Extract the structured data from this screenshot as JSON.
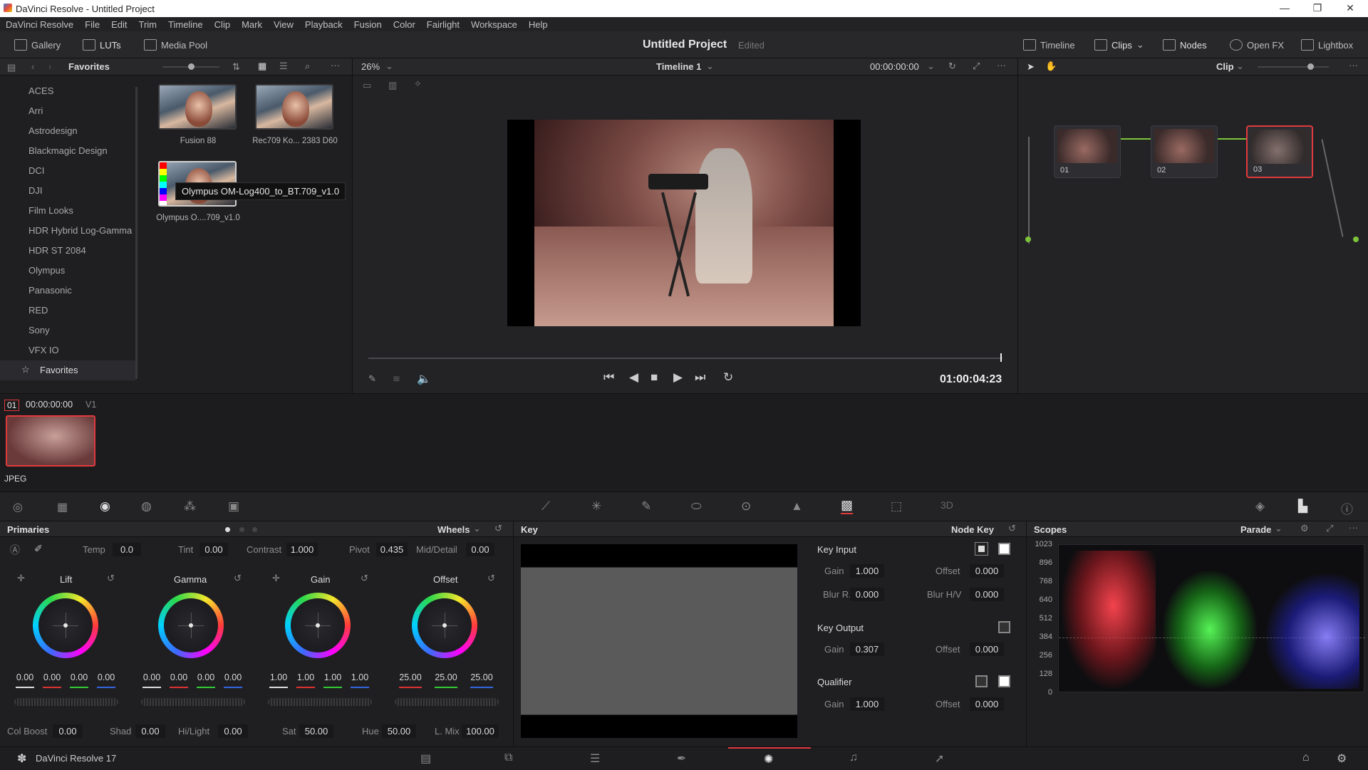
{
  "window": {
    "title": "DaVinci Resolve - Untitled Project",
    "minimize": "—",
    "maximize": "❐",
    "close": "✕"
  },
  "menu": [
    "DaVinci Resolve",
    "File",
    "Edit",
    "Trim",
    "Timeline",
    "Clip",
    "Mark",
    "View",
    "Playback",
    "Fusion",
    "Color",
    "Fairlight",
    "Workspace",
    "Help"
  ],
  "toolbar": {
    "gallery": "Gallery",
    "luts": "LUTs",
    "media_pool": "Media Pool",
    "project_title": "Untitled Project",
    "project_status": "Edited",
    "timeline": "Timeline",
    "clips": "Clips",
    "nodes": "Nodes",
    "open_fx": "Open FX",
    "lightbox": "Lightbox"
  },
  "lut_browser": {
    "title": "Favorites",
    "categories": [
      "ACES",
      "Arri",
      "Astrodesign",
      "Blackmagic Design",
      "DCI",
      "DJI",
      "Film Looks",
      "HDR Hybrid Log-Gamma",
      "HDR ST 2084",
      "Olympus",
      "Panasonic",
      "RED",
      "Sony",
      "VFX IO",
      "Favorites"
    ],
    "thumbnails": [
      {
        "label": "Fusion 88"
      },
      {
        "label": "Rec709 Ko... 2383 D60"
      },
      {
        "label": "Olympus O....709_v1.0"
      }
    ],
    "tooltip": "Olympus OM-Log400_to_BT.709_v1.0"
  },
  "viewer": {
    "zoom": "26%",
    "timeline_name": "Timeline 1",
    "timecode_top": "00:00:00:00",
    "timecode": "01:00:04:23",
    "clip_mode": "Clip"
  },
  "clip_strip": {
    "index": "01",
    "timecode": "00:00:00:00",
    "track": "V1",
    "format": "JPEG"
  },
  "primaries": {
    "title": "Primaries",
    "mode": "Wheels",
    "temp_label": "Temp",
    "temp": "0.0",
    "tint_label": "Tint",
    "tint": "0.00",
    "contrast_label": "Contrast",
    "contrast": "1.000",
    "pivot_label": "Pivot",
    "pivot": "0.435",
    "middetail_label": "Mid/Detail",
    "middetail": "0.00",
    "wheels": [
      {
        "name": "Lift",
        "values": [
          "0.00",
          "0.00",
          "0.00",
          "0.00"
        ]
      },
      {
        "name": "Gamma",
        "values": [
          "0.00",
          "0.00",
          "0.00",
          "0.00"
        ]
      },
      {
        "name": "Gain",
        "values": [
          "1.00",
          "1.00",
          "1.00",
          "1.00"
        ]
      },
      {
        "name": "Offset",
        "values": [
          "25.00",
          "25.00",
          "25.00"
        ]
      }
    ],
    "colboost_label": "Col Boost",
    "colboost": "0.00",
    "shad_label": "Shad",
    "shad": "0.00",
    "hilight_label": "Hi/Light",
    "hilight": "0.00",
    "sat_label": "Sat",
    "sat": "50.00",
    "hue_label": "Hue",
    "hue": "50.00",
    "lmix_label": "L. Mix",
    "lmix": "100.00"
  },
  "key": {
    "title": "Key",
    "node_key": "Node Key",
    "key_input": "Key Input",
    "key_output": "Key Output",
    "qualifier": "Qualifier",
    "gain_label": "Gain",
    "offset_label": "Offset",
    "blur_r_label": "Blur R.",
    "blur_hv_label": "Blur H/V",
    "input_gain": "1.000",
    "input_offset": "0.000",
    "blur_r": "0.000",
    "blur_hv": "0.000",
    "output_gain": "0.307",
    "output_offset": "0.000",
    "qual_gain": "1.000",
    "qual_offset": "0.000"
  },
  "scopes": {
    "title": "Scopes",
    "mode": "Parade",
    "ticks": [
      "1023",
      "896",
      "768",
      "640",
      "512",
      "384",
      "256",
      "128",
      "0"
    ]
  },
  "nodes": [
    "01",
    "02",
    "03"
  ],
  "footer": {
    "app": "DaVinci Resolve 17"
  },
  "colors": {
    "accent_red": "#e03a3e",
    "panel_bg": "#1f1f22",
    "header_bg": "#28282b"
  }
}
